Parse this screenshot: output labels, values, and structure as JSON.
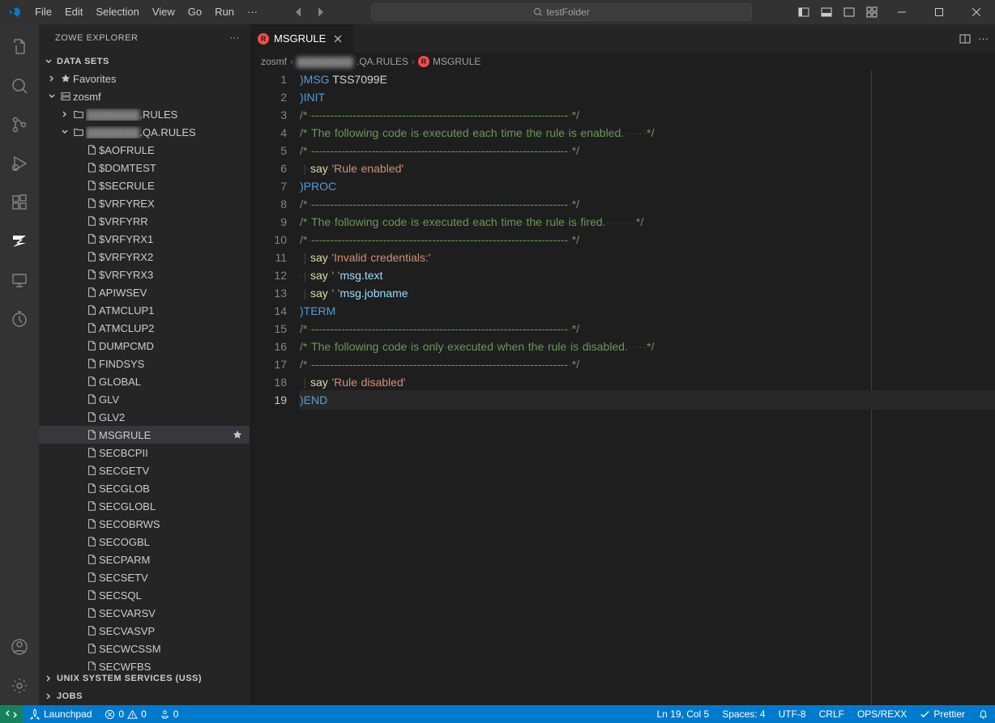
{
  "title_bar": {
    "menu": [
      "File",
      "Edit",
      "Selection",
      "View",
      "Go",
      "Run"
    ],
    "search_text": "testFolder"
  },
  "sidebar": {
    "title": "ZOWE EXPLORER",
    "sections": {
      "datasets": "DATA SETS",
      "uss": "UNIX SYSTEM SERVICES (USS)",
      "jobs": "JOBS"
    },
    "tree": {
      "favorites": "Favorites",
      "zosmf": "zosmf",
      "rules1": ".RULES",
      "rules2": ".QA.RULES",
      "members": [
        "$AOFRULE",
        "$DOMTEST",
        "$SECRULE",
        "$VRFYREX",
        "$VRFYRR",
        "$VRFYRX1",
        "$VRFYRX2",
        "$VRFYRX3",
        "APIWSEV",
        "ATMCLUP1",
        "ATMCLUP2",
        "DUMPCMD",
        "FINDSYS",
        "GLOBAL",
        "GLV",
        "GLV2",
        "MSGRULE",
        "SECBCPII",
        "SECGETV",
        "SECGLOB",
        "SECGLOBL",
        "SECOBRWS",
        "SECOGBL",
        "SECPARM",
        "SECSETV",
        "SECSQL",
        "SECVARSV",
        "SECVASVP",
        "SECWCSSM",
        "SECWFBS"
      ],
      "selected_index": 16
    }
  },
  "editor": {
    "tab": {
      "name": "MSGRULE"
    },
    "breadcrumb": {
      "root": "zosmf",
      "ds": ".QA.RULES",
      "member": "MSGRULE"
    },
    "lines": [
      {
        "n": 1,
        "t": [
          [
            "blue",
            ")MSG"
          ],
          [
            "plain",
            " TSS7099E"
          ]
        ]
      },
      {
        "n": 2,
        "t": [
          [
            "blue",
            ")INIT"
          ]
        ]
      },
      {
        "n": 3,
        "comment": "/*·--------------------------------------------------------------------·*/"
      },
      {
        "n": 4,
        "comment": "/*·The·following·code·is·executed·each·time·the·rule·is·enabled.······*/"
      },
      {
        "n": 5,
        "comment": "/*·--------------------------------------------------------------------·*/"
      },
      {
        "n": 6,
        "say": "'Rule·enabled'"
      },
      {
        "n": 7,
        "t": [
          [
            "blue",
            ")PROC"
          ]
        ]
      },
      {
        "n": 8,
        "comment": "/*·--------------------------------------------------------------------·*/"
      },
      {
        "n": 9,
        "comment": "/*·The·following·code·is·executed·each·time·the·rule·is·fired.········*/"
      },
      {
        "n": 10,
        "comment": "/*·--------------------------------------------------------------------·*/"
      },
      {
        "n": 11,
        "say": "'Invalid·credentials:'"
      },
      {
        "n": 12,
        "sayvar": {
          "prefix": "'·'",
          "var": "msg.text"
        }
      },
      {
        "n": 13,
        "sayvar": {
          "prefix": "'·'",
          "var": "msg.jobname"
        }
      },
      {
        "n": 14,
        "t": [
          [
            "blue",
            ")TERM"
          ]
        ]
      },
      {
        "n": 15,
        "comment": "/*·--------------------------------------------------------------------·*/"
      },
      {
        "n": 16,
        "comment": "/*·The·following·code·is·only·executed·when·the·rule·is·disabled.·····*/"
      },
      {
        "n": 17,
        "comment": "/*·--------------------------------------------------------------------·*/"
      },
      {
        "n": 18,
        "say": "'Rule·disabled'"
      },
      {
        "n": 19,
        "t": [
          [
            "blue",
            ")END"
          ]
        ],
        "current": true
      }
    ]
  },
  "status": {
    "launchpad": "Launchpad",
    "errors": "0",
    "warnings": "0",
    "ports": "0",
    "ln_col": "Ln 19, Col 5",
    "spaces": "Spaces: 4",
    "encoding": "UTF-8",
    "eol": "CRLF",
    "language": "OPS/REXX",
    "prettier": "Prettier"
  }
}
